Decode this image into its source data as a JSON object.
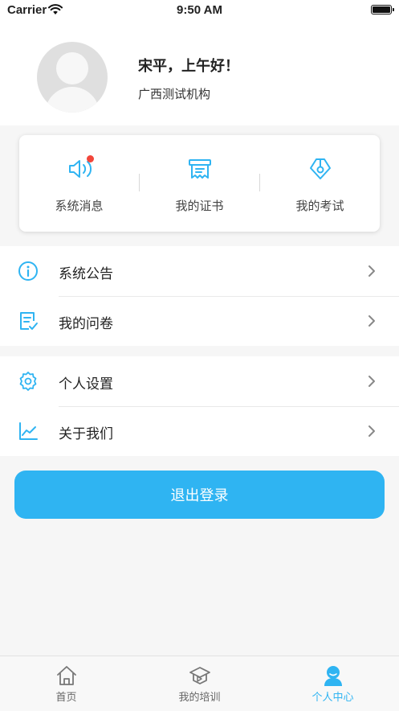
{
  "status_bar": {
    "carrier": "Carrier",
    "time": "9:50 AM"
  },
  "profile": {
    "greeting": "宋平，上午好！",
    "organization": "广西测试机构"
  },
  "quick_actions": [
    {
      "label": "系统消息",
      "icon": "speaker-icon",
      "has_badge": true
    },
    {
      "label": "我的证书",
      "icon": "certificate-icon"
    },
    {
      "label": "我的考试",
      "icon": "pen-nib-icon"
    }
  ],
  "menu_group_1": [
    {
      "label": "系统公告",
      "icon": "info-icon"
    },
    {
      "label": "我的问卷",
      "icon": "questionnaire-icon"
    }
  ],
  "menu_group_2": [
    {
      "label": "个人设置",
      "icon": "gear-icon"
    },
    {
      "label": "关于我们",
      "icon": "chart-line-icon"
    }
  ],
  "logout_label": "退出登录",
  "tabbar": [
    {
      "label": "首页",
      "icon": "home-icon",
      "active": false
    },
    {
      "label": "我的培训",
      "icon": "graduation-cap-icon",
      "active": false
    },
    {
      "label": "个人中心",
      "icon": "user-icon",
      "active": true
    }
  ],
  "colors": {
    "accent": "#2fb4f2",
    "badge": "#f2463a",
    "background": "#f6f6f6"
  }
}
